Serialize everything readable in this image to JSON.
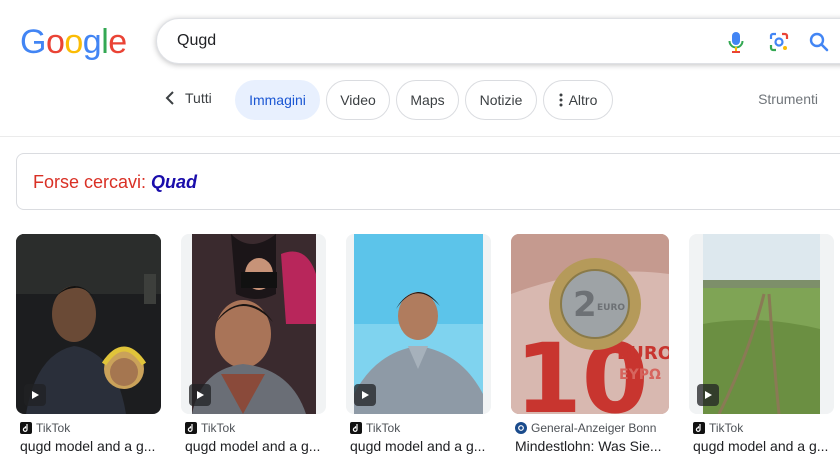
{
  "logo": {
    "letters": [
      "G",
      "o",
      "o",
      "g",
      "l",
      "e"
    ],
    "colors": [
      "#4285f4",
      "#ea4335",
      "#fbbc05",
      "#4285f4",
      "#34a853",
      "#ea4335"
    ]
  },
  "search": {
    "query": "Qugd"
  },
  "tabs": {
    "back_label": "Tutti",
    "items": [
      {
        "label": "Immagini",
        "active": true
      },
      {
        "label": "Video",
        "active": false
      },
      {
        "label": "Maps",
        "active": false
      },
      {
        "label": "Notizie",
        "active": false
      },
      {
        "label": "Altro",
        "active": false
      }
    ],
    "tools_label": "Strumenti"
  },
  "suggestion": {
    "prefix": "Forse cercavi:",
    "term": "Quad"
  },
  "results": [
    {
      "source": "TikTok",
      "title": "qugd model and a g...",
      "video": true,
      "icon": "tiktok-icon"
    },
    {
      "source": "TikTok",
      "title": "qugd model and a g...",
      "video": true,
      "icon": "tiktok-icon"
    },
    {
      "source": "TikTok",
      "title": "qugd model and a g...",
      "video": true,
      "icon": "tiktok-icon"
    },
    {
      "source": "General-Anzeiger Bonn",
      "title": "Mindestlohn: Was Sie...",
      "video": false,
      "icon": "ga-icon"
    },
    {
      "source": "TikTok",
      "title": "qugd model and a g...",
      "video": true,
      "icon": "tiktok-icon"
    }
  ]
}
